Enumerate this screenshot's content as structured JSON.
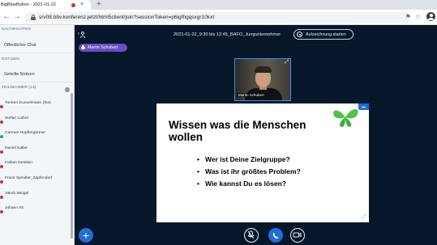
{
  "browser": {
    "tab_title": "BigBlueButton - 2021-01-22",
    "tab_close": "×",
    "new_tab": "+",
    "back": "←",
    "forward": "→",
    "url": "srv08.bbv.konferenz.jetzt/html5client/join?sessionToken=p6igfhgqsxgr10kxt",
    "extensions_icon": "⚑",
    "bookmark_icon": "☆"
  },
  "sidebar": {
    "section_messages": "NACHRICHTEN",
    "public_chat": "Öffentlicher Chat",
    "section_notes": "NOTIZEN",
    "shared_notes": "Geteilte Notizen",
    "section_users": "TEILNEHMER (13)",
    "users": [
      {
        "name": "Torsten Gunselmann (Sie)",
        "badge_color": "#d93025"
      },
      {
        "name": "Stefan Luther",
        "badge_color": "#d93025"
      },
      {
        "name": "Carmen Hopfengärtner",
        "badge_color": "#1aa3a3"
      },
      {
        "name": "Daniel Kalbe",
        "badge_color": "#d93025"
      },
      {
        "name": "Fabian Deinlein",
        "badge_color": "#d93025"
      },
      {
        "name": "Franz Spindler_Zapfendorf",
        "badge_color": "#d93025"
      },
      {
        "name": "Jakob Weigel",
        "badge_color": "#d93025"
      },
      {
        "name": "Johann Alt",
        "badge_color": "#d93025"
      }
    ]
  },
  "meeting": {
    "title": "2021-01-22_9:30 bis 12:45_BAFO_Jungunternehmer",
    "record_label": "Aufzeichnung starten",
    "talker": "Martin Schubert",
    "video_label": "Martin Schubert"
  },
  "slide": {
    "title": "Wissen was die Menschen wollen",
    "bullets": [
      "Wer ist Deine Zielgruppe?",
      "Was ist ihr größtes Problem?",
      "Wie kannst Du es lösen?"
    ]
  },
  "controls": {
    "plus": "+"
  },
  "colors": {
    "accent": "#1f6fd6",
    "talker": "#6c4bc2",
    "butterfly": "#4cc24a",
    "background": "#06172a"
  }
}
